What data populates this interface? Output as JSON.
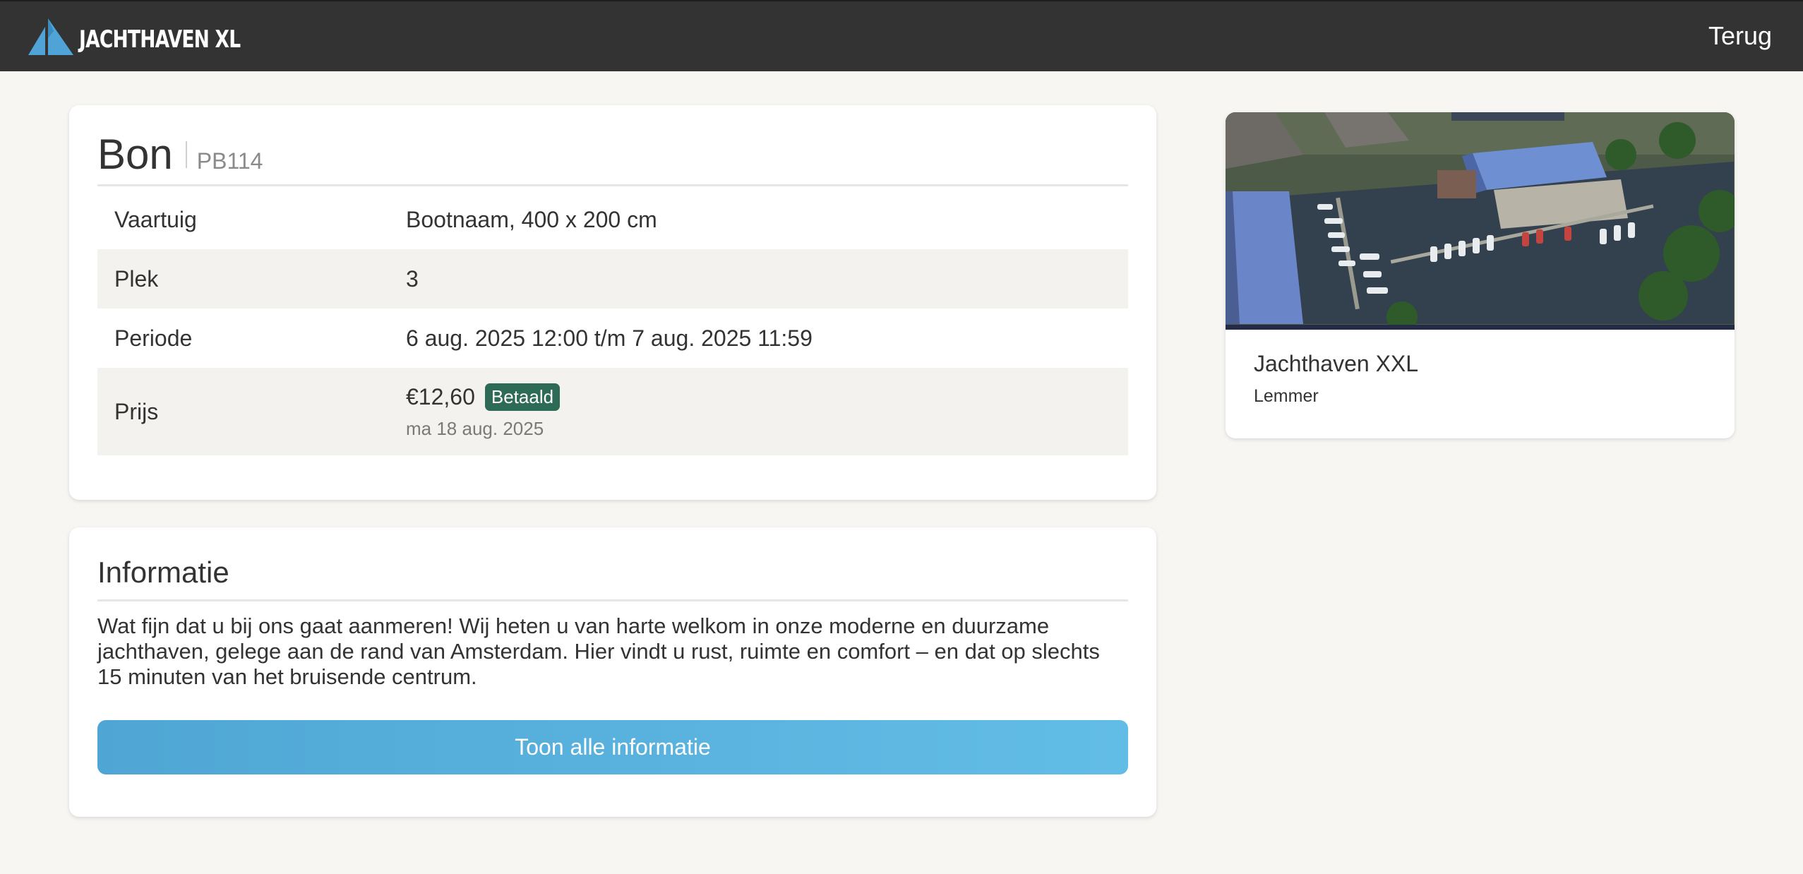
{
  "header": {
    "logo_text": "JACHTHAVEN XL",
    "back_label": "Terug"
  },
  "bon": {
    "title": "Bon",
    "code": "PB114",
    "rows": [
      {
        "label": "Vaartuig",
        "value": "Bootnaam, 400 x 200 cm"
      },
      {
        "label": "Plek",
        "value": "3"
      },
      {
        "label": "Periode",
        "value": "6 aug. 2025 12:00 t/m 7 aug. 2025 11:59"
      },
      {
        "label": "Prijs",
        "value": "€12,60"
      }
    ],
    "price_status": "Betaald",
    "price_date": "ma 18 aug. 2025"
  },
  "info": {
    "title": "Informatie",
    "text": "Wat fijn dat u bij ons gaat aanmeren! Wij heten u van harte welkom in onze moderne en duurzame jachthaven, gelege aan de rand van Amsterdam. Hier vindt u rust, ruimte en comfort – en dat op slechts 15 minuten van het bruisende centrum.",
    "button_label": "Toon alle informatie"
  },
  "harbour": {
    "name": "Jachthaven XXL",
    "city": "Lemmer"
  },
  "colors": {
    "topbar": "#333333",
    "accent": "#5ab2df",
    "badge": "#2e6b57",
    "logo_sail": "#4fa3d6"
  }
}
